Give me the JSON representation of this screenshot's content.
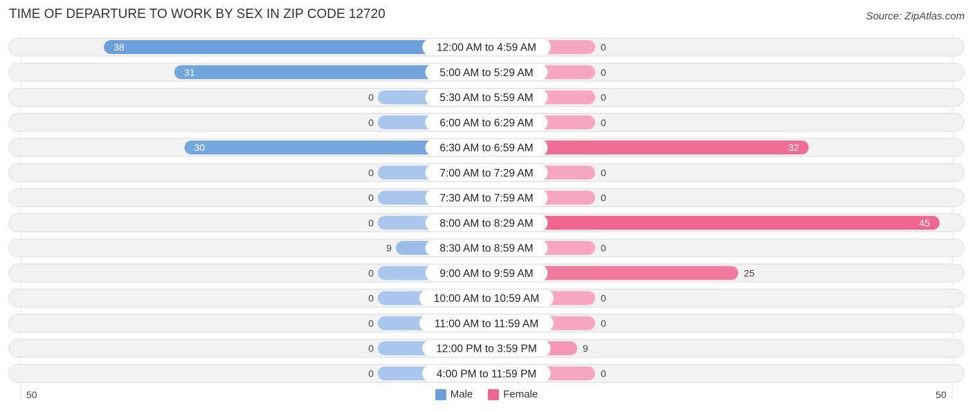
{
  "title": "TIME OF DEPARTURE TO WORK BY SEX IN ZIP CODE 12720",
  "source": "Source: ZipAtlas.com",
  "colors": {
    "male": "#6a9fdb",
    "male_light": "#a9c7ec",
    "female": "#f06690",
    "female_light": "#f6a6c0",
    "row_bg": "#f2f2f2"
  },
  "chart_data": {
    "type": "bar",
    "orientation": "horizontal-diverging",
    "title": "TIME OF DEPARTURE TO WORK BY SEX IN ZIP CODE 12720",
    "categories": [
      "12:00 AM to 4:59 AM",
      "5:00 AM to 5:29 AM",
      "5:30 AM to 5:59 AM",
      "6:00 AM to 6:29 AM",
      "6:30 AM to 6:59 AM",
      "7:00 AM to 7:29 AM",
      "7:30 AM to 7:59 AM",
      "8:00 AM to 8:29 AM",
      "8:30 AM to 8:59 AM",
      "9:00 AM to 9:59 AM",
      "10:00 AM to 10:59 AM",
      "11:00 AM to 11:59 AM",
      "12:00 PM to 3:59 PM",
      "4:00 PM to 11:59 PM"
    ],
    "series": [
      {
        "name": "Male",
        "side": "left",
        "values": [
          38,
          31,
          0,
          0,
          30,
          0,
          0,
          0,
          9,
          0,
          0,
          0,
          0,
          0
        ]
      },
      {
        "name": "Female",
        "side": "right",
        "values": [
          0,
          0,
          0,
          0,
          32,
          0,
          0,
          45,
          0,
          25,
          0,
          0,
          9,
          0
        ]
      }
    ],
    "xlim": [
      -50,
      50
    ],
    "axis_tick_labels": {
      "left": "50",
      "right": "50"
    },
    "legend": {
      "position": "bottom-center",
      "entries": [
        "Male",
        "Female"
      ]
    },
    "grid": false
  }
}
